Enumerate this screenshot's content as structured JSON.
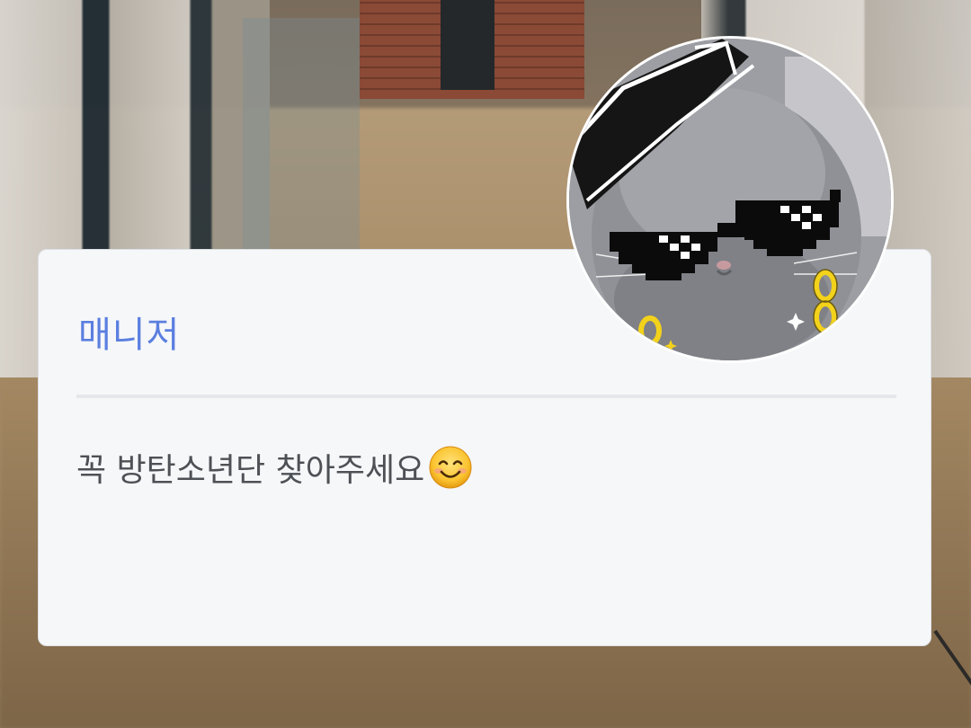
{
  "card": {
    "title": "매니저",
    "message": "꼭 방탄소년단 찾아주세요",
    "message_emoji": "smiling-face-icon"
  },
  "avatar": {
    "icon": "cat-with-sunglasses-avatar"
  },
  "colors": {
    "title": "#5b7fe0",
    "message": "#4d5055",
    "card_bg": "#f6f7f9"
  }
}
